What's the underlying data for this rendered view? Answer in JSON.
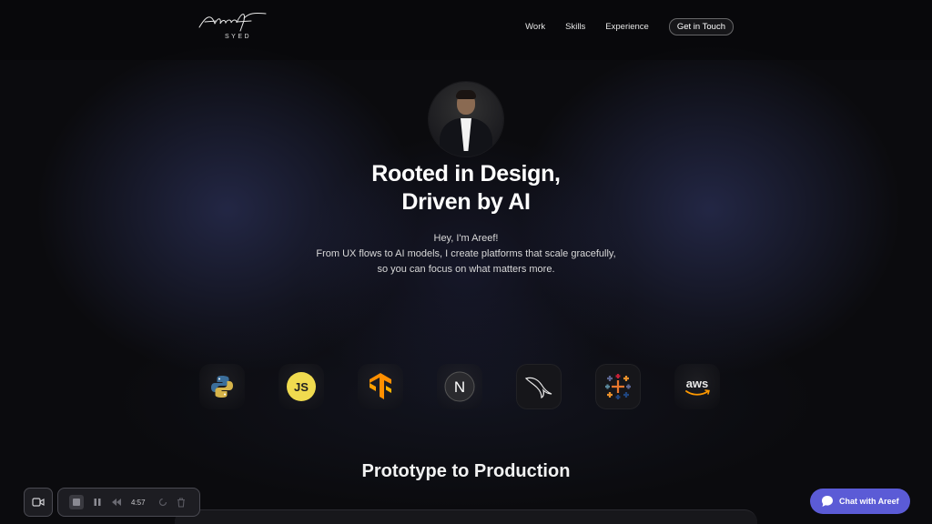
{
  "brand": {
    "logo_script": "Areef",
    "logo_sub": "SYED"
  },
  "nav": {
    "items": [
      {
        "label": "Work"
      },
      {
        "label": "Skills"
      },
      {
        "label": "Experience"
      }
    ],
    "cta_label": "Get in Touch"
  },
  "hero": {
    "title_line1": "Rooted in Design,",
    "title_line2": "Driven by AI",
    "sub_line1": "Hey, I'm Areef!",
    "sub_line2": "From UX flows to AI models, I create platforms that scale gracefully,",
    "sub_line3": "so you can focus on what matters more."
  },
  "tools": [
    {
      "icon": "python-icon"
    },
    {
      "icon": "javascript-icon",
      "label": "JS"
    },
    {
      "icon": "tensorflow-icon"
    },
    {
      "icon": "nextjs-icon",
      "label": "N"
    },
    {
      "icon": "mysql-icon"
    },
    {
      "icon": "tableau-icon"
    },
    {
      "icon": "aws-icon",
      "label": "aws"
    }
  ],
  "section": {
    "title": "Prototype to Production"
  },
  "recorder": {
    "time": "4:57"
  },
  "chat": {
    "label": "Chat with Areef"
  },
  "colors": {
    "background": "#0b0b0e",
    "chat_accent": "#5b5bd6",
    "js_yellow": "#f0db4f",
    "tensorflow_orange": "#ff8f00"
  }
}
